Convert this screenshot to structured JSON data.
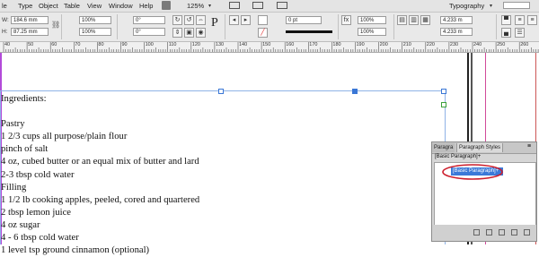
{
  "menu": {
    "items": [
      "le",
      "Type",
      "Object",
      "Table",
      "View",
      "Window",
      "Help"
    ],
    "zoom": "125%",
    "workspace": "Typography"
  },
  "control": {
    "w_label": "W:",
    "h_label": "H:",
    "w_value": "184.6 mm",
    "h_value": "87.25 mm",
    "scale_x": "100%",
    "scale_y": "100%",
    "rotate": "0°",
    "shear": "0°",
    "stroke_weight": "0 pt",
    "opacity_1": "100%",
    "opacity_2": "100%",
    "gutter_1": "4.233 m",
    "gutter_2": "4.233 m"
  },
  "ruler": {
    "labels": [
      "40",
      "50",
      "60",
      "70",
      "80",
      "90",
      "100",
      "110",
      "120",
      "130",
      "140",
      "150",
      "160",
      "170",
      "180",
      "190",
      "200",
      "210",
      "220",
      "230",
      "240",
      "250",
      "260"
    ]
  },
  "story": {
    "lines": [
      "Ingredients:",
      "",
      "Pastry",
      "1 2/3 cups all purpose/plain flour",
      "pinch of salt",
      "4 oz, cubed butter or an equal mix of butter and lard",
      "2-3 tbsp cold water",
      "Filling",
      "1 1/2 lb cooking apples, peeled, cored and quartered",
      "2 tbsp lemon juice",
      "4 oz sugar",
      "4 - 6 tbsp cold water",
      "1 level tsp ground cinnamon (optional)"
    ]
  },
  "panel": {
    "tab_1": "Paragra",
    "tab_2": "Paragraph Styles",
    "current_style": "[Basic Paragraph]+",
    "list_item": "[Basic Paragraph]+",
    "highlight_color": "#3b79d8",
    "annotation_color": "#cc1d2b"
  }
}
